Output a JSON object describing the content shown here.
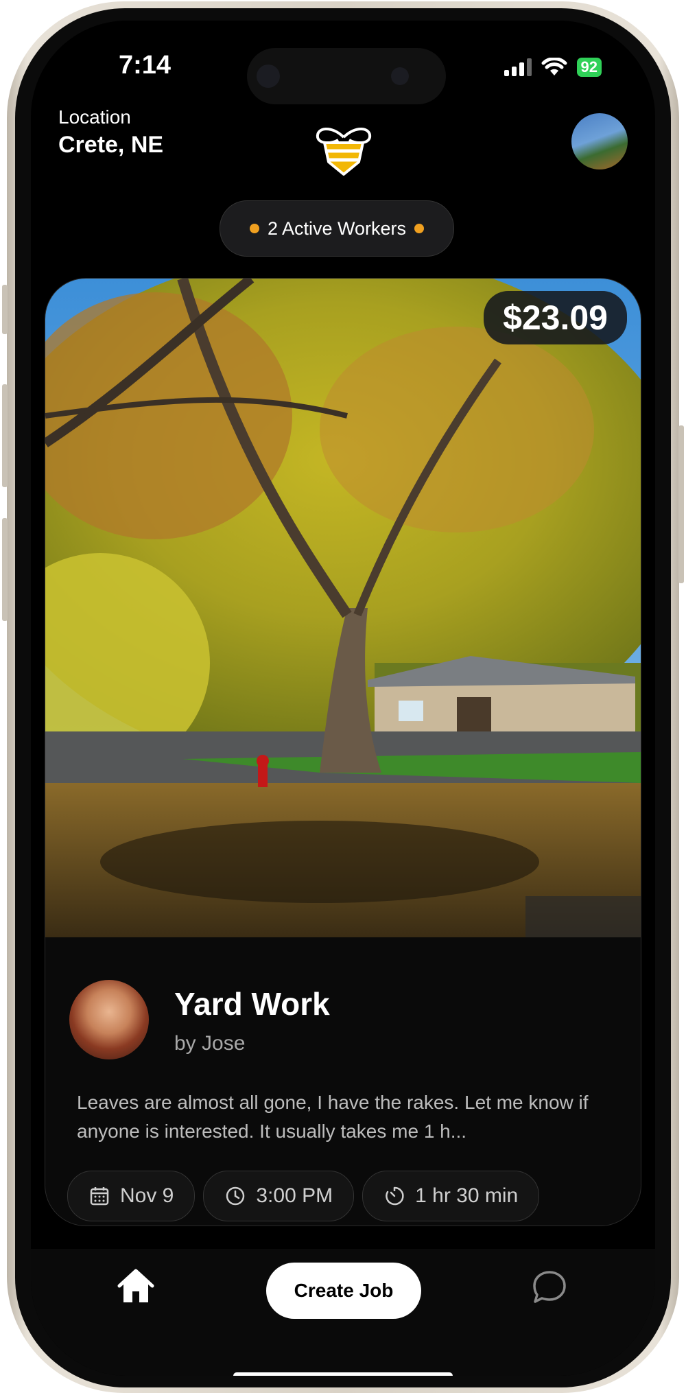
{
  "status": {
    "time": "7:14",
    "battery": "92"
  },
  "header": {
    "location_label": "Location",
    "location_value": "Crete, NE"
  },
  "workers_pill": {
    "text": "2 Active Workers"
  },
  "job": {
    "price": "$23.09",
    "title": "Yard Work",
    "by": "by Jose",
    "description": "Leaves are almost all gone, I have the rakes. Let me know if anyone is interested. It usually takes me 1 h...",
    "date": "Nov 9",
    "time": "3:00 PM",
    "duration": "1 hr 30 min"
  },
  "nav": {
    "create_label": "Create Job"
  },
  "icons": [
    "bee-logo-icon",
    "home-icon",
    "chat-icon",
    "calendar-icon",
    "clock-icon",
    "timer-icon"
  ],
  "colors": {
    "accent_dot": "#f0a020",
    "battery": "#30d158",
    "bee": "#f2b705"
  }
}
